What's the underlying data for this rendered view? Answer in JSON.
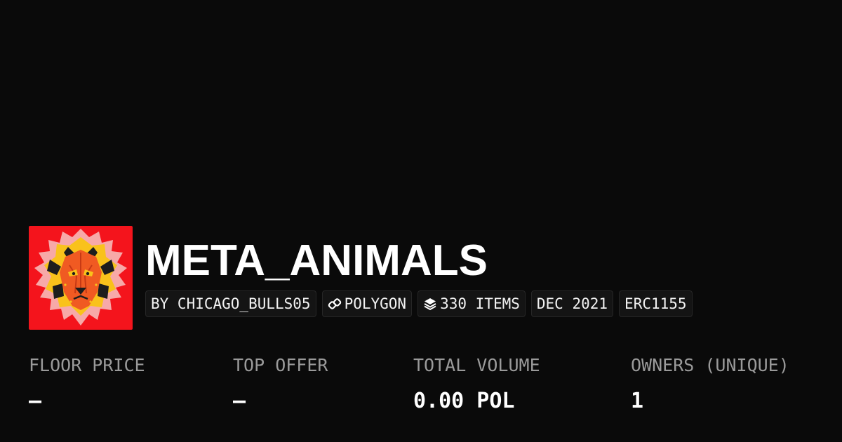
{
  "collection": {
    "name": "META_ANIMALS",
    "avatar_icon": "lion-face-icon",
    "avatar_color": "#f4141c"
  },
  "badges": {
    "creator": "BY CHICAGO_BULLS05",
    "chain": "POLYGON",
    "chain_icon": "link-icon",
    "items": "330 ITEMS",
    "items_icon": "layers-icon",
    "created": "DEC 2021",
    "standard": "ERC1155"
  },
  "stats": [
    {
      "label": "FLOOR PRICE",
      "value": "–"
    },
    {
      "label": "TOP OFFER",
      "value": "–"
    },
    {
      "label": "TOTAL VOLUME",
      "value": "0.00 POL"
    },
    {
      "label": "OWNERS (UNIQUE)",
      "value": "1"
    }
  ],
  "colors": {
    "background": "#0a0a0a",
    "label": "#9a9a9a",
    "value": "#ffffff"
  }
}
